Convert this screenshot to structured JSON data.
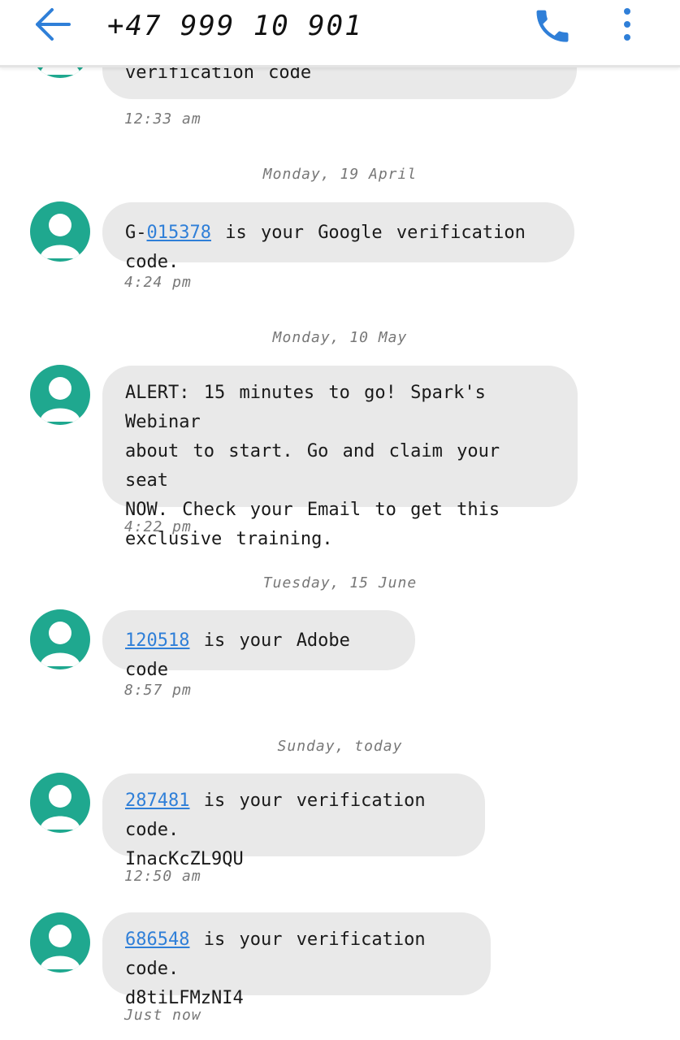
{
  "header": {
    "phone_number": "+47 999 10 901",
    "back_icon": "arrow-left-icon",
    "call_icon": "phone-icon",
    "menu_icon": "more-vertical-icon"
  },
  "colors": {
    "accent": "#2f7fd8",
    "avatar": "#1fa88f",
    "bubble": "#e9e9e9"
  },
  "messages": {
    "m0": {
      "text": "verification code",
      "time": "12:33 am"
    },
    "d1": "Monday, 19 April",
    "m1": {
      "prefix": "G-",
      "code": "015378",
      "suffix": " is your Google verification code.",
      "time": "4:24 pm"
    },
    "d2": "Monday, 10 May",
    "m2": {
      "line1": "ALERT: 15 minutes to go! Spark's Webinar",
      "line2": "about to start. Go and claim your seat",
      "line3": "NOW. Check your Email to get this",
      "line4": "exclusive training.",
      "time": "4:22 pm"
    },
    "d3": "Tuesday, 15 June",
    "m3": {
      "code": "120518",
      "suffix": " is your Adobe code",
      "time": "8:57 pm"
    },
    "d4": "Sunday, today",
    "m4": {
      "code": "287481",
      "suffix": " is your verification code.",
      "line2": "InacKcZL9QU",
      "time": "12:50 am"
    },
    "m5": {
      "code": "686548",
      "suffix": " is your verification code.",
      "line2": "d8tiLFMzNI4",
      "time": "Just now"
    }
  }
}
